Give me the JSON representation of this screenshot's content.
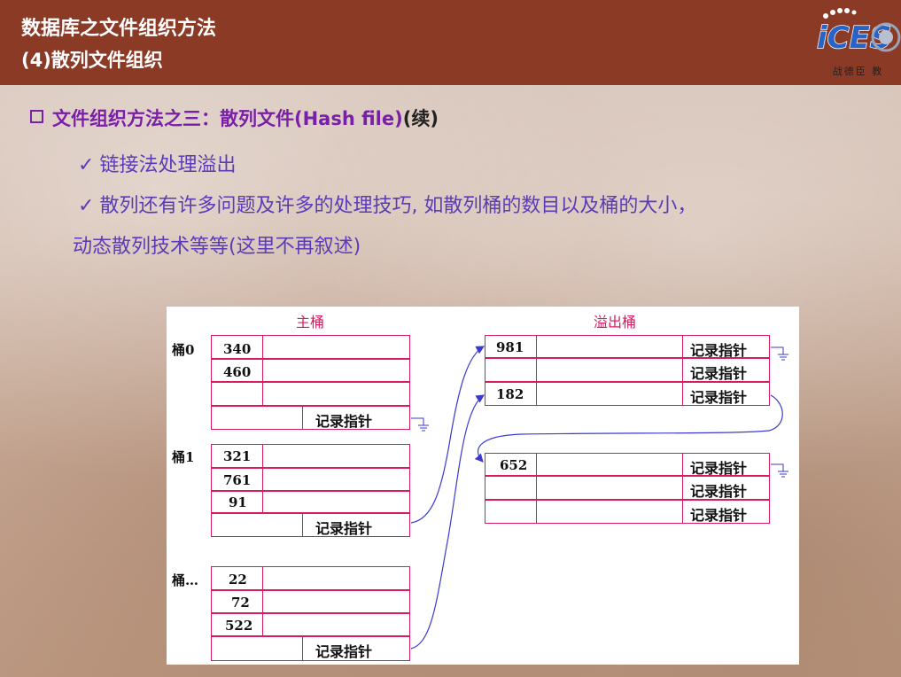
{
  "header": {
    "title_line1": "数据库之文件组织方法",
    "title_line2": "(4)散列文件组织",
    "logo_text": "iCES",
    "logo_subtext": "战德臣 教"
  },
  "colors": {
    "title_bar": "#8b3a26",
    "heading": "#7a1fa8",
    "bullet_text": "#5b3bb8",
    "diagram_border": "#d81b60",
    "arrow": "#3a3ad0"
  },
  "content": {
    "heading_main": "文件组织方法之三：散列文件(Hash file)",
    "heading_suffix": "(续)",
    "bullet1": "链接法处理溢出",
    "bullet2_line1": "散列还有许多问题及许多的处理技巧, 如散列桶的数目以及桶的大小，",
    "bullet2_line2": "动态散列技术等等(这里不再叙述)",
    "check_mark": "✓"
  },
  "diagram": {
    "main_header": "主桶",
    "overflow_header": "溢出桶",
    "pointer_label": "记录指针",
    "main_buckets": [
      {
        "label": "桶0",
        "records": [
          "340",
          "460",
          ""
        ]
      },
      {
        "label": "桶1",
        "records": [
          "321",
          "761",
          "91"
        ]
      },
      {
        "label": "桶…",
        "records": [
          "22",
          "72",
          "522"
        ]
      }
    ],
    "overflow_buckets": [
      {
        "records": [
          "981",
          "",
          "182"
        ]
      },
      {
        "records": [
          "652",
          "",
          ""
        ]
      }
    ]
  }
}
